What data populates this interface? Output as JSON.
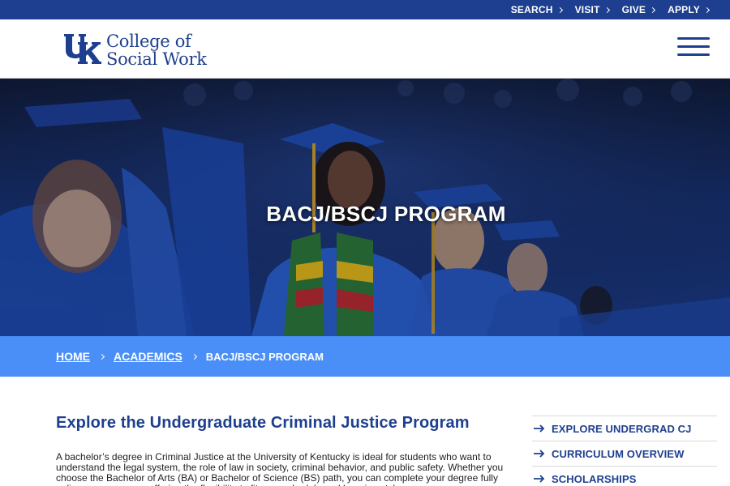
{
  "utility_nav": [
    {
      "label": "SEARCH"
    },
    {
      "label": "VISIT"
    },
    {
      "label": "GIVE"
    },
    {
      "label": "APPLY"
    }
  ],
  "header": {
    "logo_line1": "College of",
    "logo_line2": "Social Work",
    "brand_color": "#1e3f8f"
  },
  "hero": {
    "title": "BACJ/BSCJ PROGRAM"
  },
  "breadcrumb": {
    "home": "HOME",
    "academics": "ACADEMICS",
    "current": "BACJ/BSCJ PROGRAM",
    "bar_color": "#4a8ff7"
  },
  "main": {
    "heading": "Explore the Undergraduate Criminal Justice Program",
    "body": "A bachelor’s degree in Criminal Justice at the University of Kentucky is ideal for students who want to understand the legal system, the role of law in society, criminal behavior, and public safety. Whether you choose the Bachelor of Arts (BA) or Bachelor of Science (BS) path, you can complete your degree fully online or on campus, offering the flexibility to fit your schedule and learning style."
  },
  "sidebar": {
    "items": [
      {
        "label": "EXPLORE UNDERGRAD CJ"
      },
      {
        "label": "CURRICULUM OVERVIEW"
      },
      {
        "label": "SCHOLARSHIPS"
      }
    ]
  }
}
